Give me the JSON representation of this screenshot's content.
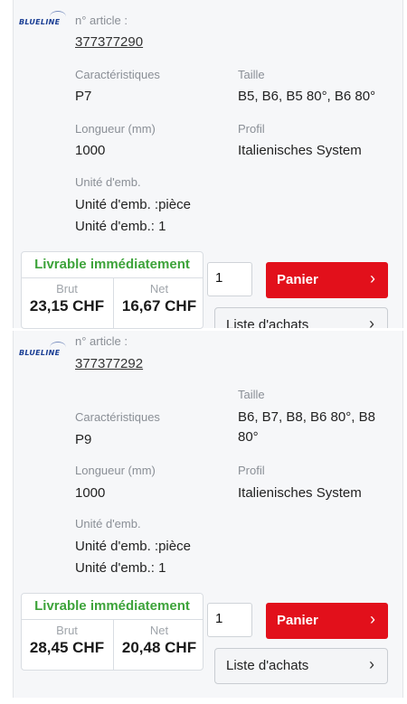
{
  "logo_text": "BLUELINE",
  "labels": {
    "article": "n° article :",
    "caracteristiques": "Caractéristiques",
    "taille": "Taille",
    "longueur": "Longueur (mm)",
    "profil": "Profil",
    "unite": "Unité d'emb."
  },
  "buttons": {
    "cart": "Panier",
    "list": "Liste d'achats"
  },
  "chevron": "›",
  "products": [
    {
      "article_number": "377377290",
      "caracteristiques": "P7",
      "taille": "B5, B6, B5 80°, B6 80°",
      "longueur": "1000",
      "profil": "Italienisches System",
      "unite_line1": "Unité d'emb. :pièce",
      "unite_line2": "Unité d'emb.: 1",
      "availability": "Livrable immédiatement",
      "brut_label": "Brut",
      "brut_price": "23,15 CHF",
      "net_label": "Net",
      "net_price": "16,67 CHF",
      "quantity": "1"
    },
    {
      "article_number": "377377292",
      "caracteristiques": "P9",
      "taille": "B6, B7, B8, B6 80°, B8 80°",
      "longueur": "1000",
      "profil": "Italienisches System",
      "unite_line1": "Unité d'emb. :pièce",
      "unite_line2": "Unité d'emb.: 1",
      "availability": "Livrable immédiatement",
      "brut_label": "Brut",
      "brut_price": "28,45 CHF",
      "net_label": "Net",
      "net_price": "20,48 CHF",
      "quantity": "1"
    }
  ]
}
